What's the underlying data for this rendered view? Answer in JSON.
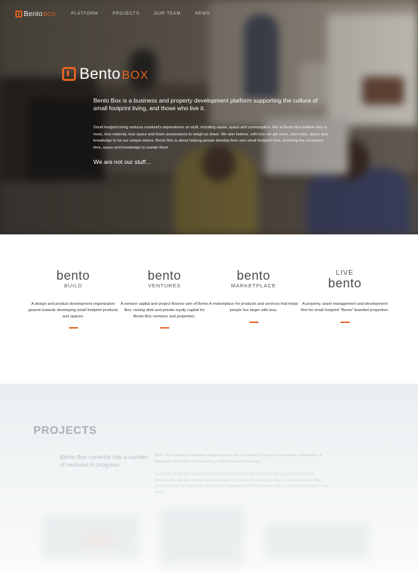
{
  "nav": {
    "logo": {
      "word1": "Bento",
      "word2": "BOX"
    },
    "items": [
      {
        "label": "PLATFORM"
      },
      {
        "label": "PROJECTS"
      },
      {
        "label": "OUR TEAM"
      },
      {
        "label": "NEWS"
      }
    ]
  },
  "hero": {
    "logo": {
      "word1": "Bento",
      "word2": "BOX"
    },
    "lead": "Bento Box is a business and property development platform supporting the culture of small footprint living, and those who live it.",
    "body": "Small footprint living reduces mankind's dependence on stuff, including waste, space and consumption. We at Bento Box believe less is more, less material, less space and fewer possessions to weigh us down. We also believe, with less we get more, more time, space and knowledge to be our unique selves. Bento Box is about helping people develop their own small footprint lives, including the necessary time, space and knowledge to sustain them.",
    "tagline": "We are not our stuff..."
  },
  "ventures": [
    {
      "logo_top": "bento",
      "logo_bottom": "BUILD",
      "description": "A design and product development organization geared towards developing small footprint products and spaces."
    },
    {
      "logo_top": "bento",
      "logo_bottom": "VENTURES",
      "description": "A venture capital and project finance arm of Bento Box, raising debt and private equity capital for Bento Box ventures and properties."
    },
    {
      "logo_top": "bento",
      "logo_bottom": "MARKETPLACE",
      "description": "A marketplace for products and services that helps people live larger with less."
    },
    {
      "logo_top": "LIVE",
      "logo_bottom": "bento",
      "description": "A property, asset management and development firm for small footprint \"Bento\" branded properties."
    }
  ],
  "projects": {
    "title": "PROJECTS",
    "subtitle": "Bento Box currently has a number of ventures in progress.",
    "paragraph1": "Bento Build enables minimalist design ideas to become reality through the innovative collaboration of designers, craftsmen, entrepreneurs, producers and consumers.",
    "paragraph2": "Live Bento properties inspire open-minded individuals to live and work with greater freedom and intentionality. We also design and build properties, space involving a privacy, community-like at thing community, live among others of work and engages to add engagement with a community of those in the space."
  },
  "colors": {
    "accent": "#e0621f",
    "hero_text": "#ffffff",
    "projects_title": "#a9b2b6"
  }
}
